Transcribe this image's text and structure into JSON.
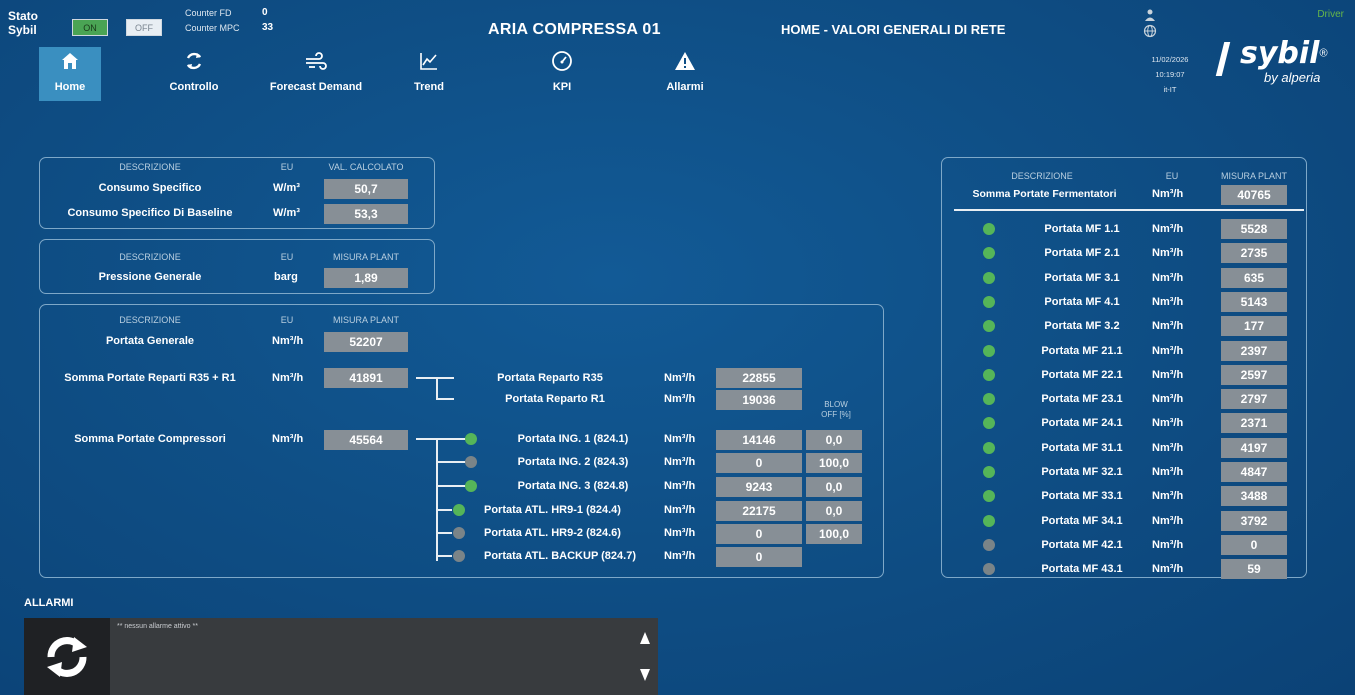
{
  "header": {
    "stato_label": "Stato\nSybil",
    "toggle_on": "ON",
    "toggle_off": "OFF",
    "counter_fd_label": "Counter FD",
    "counter_fd_value": "0",
    "counter_mpc_label": "Counter MPC",
    "counter_mpc_value": "33",
    "app_title": "ARIA COMPRESSA 01",
    "page_title": "HOME - VALORI GENERALI DI RETE",
    "driver": "Driver",
    "date": "11/02/2026",
    "time": "10:19:07",
    "locale": "it-IT",
    "logo_main": "sybil",
    "logo_reg": "®",
    "logo_by": "by alperia"
  },
  "nav": [
    {
      "label": "Home",
      "icon": "home-icon"
    },
    {
      "label": "Controllo",
      "icon": "cycle-icon"
    },
    {
      "label": "Forecast Demand",
      "icon": "wind-icon"
    },
    {
      "label": "Trend",
      "icon": "trend-chart-icon"
    },
    {
      "label": "KPI",
      "icon": "gauge-icon"
    },
    {
      "label": "Allarmi",
      "icon": "warning-icon"
    }
  ],
  "panel_consumo": {
    "h_desc": "DESCRIZIONE",
    "h_eu": "EU",
    "h_val": "VAL. CALCOLATO",
    "rows": [
      {
        "label": "Consumo Specifico",
        "unit": "W/m³",
        "value": "50,7"
      },
      {
        "label": "Consumo Specifico Di Baseline",
        "unit": "W/m³",
        "value": "53,3"
      }
    ]
  },
  "panel_pressione": {
    "h_desc": "DESCRIZIONE",
    "h_eu": "EU",
    "h_val": "MISURA PLANT",
    "rows": [
      {
        "label": "Pressione Generale",
        "unit": "barg",
        "value": "1,89"
      }
    ]
  },
  "panel_portata": {
    "h_desc": "DESCRIZIONE",
    "h_eu": "EU",
    "h_val": "MISURA PLANT",
    "blowoff": "BLOW\nOFF [%]",
    "generale": {
      "label": "Portata Generale",
      "unit": "Nm³/h",
      "value": "52207"
    },
    "reparti": {
      "label": "Somma Portate Reparti R35 + R1",
      "unit": "Nm³/h",
      "value": "41891"
    },
    "compressori": {
      "label": "Somma Portate Compressori",
      "unit": "Nm³/h",
      "value": "45564"
    },
    "reparti_children": [
      {
        "label": "Portata Reparto R35",
        "unit": "Nm³/h",
        "value": "22855"
      },
      {
        "label": "Portata Reparto R1",
        "unit": "Nm³/h",
        "value": "19036"
      }
    ],
    "compressori_children": [
      {
        "label": "Portata ING. 1 (824.1)",
        "unit": "Nm³/h",
        "value": "14146",
        "blowoff": "0,0",
        "status": "green"
      },
      {
        "label": "Portata ING. 2 (824.3)",
        "unit": "Nm³/h",
        "value": "0",
        "blowoff": "100,0",
        "status": "grey"
      },
      {
        "label": "Portata ING. 3 (824.8)",
        "unit": "Nm³/h",
        "value": "9243",
        "blowoff": "0,0",
        "status": "green"
      },
      {
        "label": "Portata ATL. HR9-1 (824.4)",
        "unit": "Nm³/h",
        "value": "22175",
        "blowoff": "0,0",
        "status": "green"
      },
      {
        "label": "Portata ATL. HR9-2 (824.6)",
        "unit": "Nm³/h",
        "value": "0",
        "blowoff": "100,0",
        "status": "grey"
      },
      {
        "label": "Portata ATL. BACKUP (824.7)",
        "unit": "Nm³/h",
        "value": "0",
        "blowoff": "",
        "status": "grey"
      }
    ]
  },
  "panel_fermentatori": {
    "h_desc": "DESCRIZIONE",
    "h_eu": "EU",
    "h_val": "MISURA PLANT",
    "somma": {
      "label": "Somma Portate Fermentatori",
      "unit": "Nm³/h",
      "value": "40765"
    },
    "rows": [
      {
        "label": "Portata MF 1.1",
        "unit": "Nm³/h",
        "value": "5528",
        "status": "green"
      },
      {
        "label": "Portata MF 2.1",
        "unit": "Nm³/h",
        "value": "2735",
        "status": "green"
      },
      {
        "label": "Portata MF 3.1",
        "unit": "Nm³/h",
        "value": "635",
        "status": "green"
      },
      {
        "label": "Portata MF 4.1",
        "unit": "Nm³/h",
        "value": "5143",
        "status": "green"
      },
      {
        "label": "Portata MF 3.2",
        "unit": "Nm³/h",
        "value": "177",
        "status": "green"
      },
      {
        "label": "Portata MF 21.1",
        "unit": "Nm³/h",
        "value": "2397",
        "status": "green"
      },
      {
        "label": "Portata MF 22.1",
        "unit": "Nm³/h",
        "value": "2597",
        "status": "green"
      },
      {
        "label": "Portata MF 23.1",
        "unit": "Nm³/h",
        "value": "2797",
        "status": "green"
      },
      {
        "label": "Portata MF 24.1",
        "unit": "Nm³/h",
        "value": "2371",
        "status": "green"
      },
      {
        "label": "Portata MF 31.1",
        "unit": "Nm³/h",
        "value": "4197",
        "status": "green"
      },
      {
        "label": "Portata MF 32.1",
        "unit": "Nm³/h",
        "value": "4847",
        "status": "green"
      },
      {
        "label": "Portata MF 33.1",
        "unit": "Nm³/h",
        "value": "3488",
        "status": "green"
      },
      {
        "label": "Portata MF 34.1",
        "unit": "Nm³/h",
        "value": "3792",
        "status": "green"
      },
      {
        "label": "Portata MF 42.1",
        "unit": "Nm³/h",
        "value": "0",
        "status": "grey"
      },
      {
        "label": "Portata MF 43.1",
        "unit": "Nm³/h",
        "value": "59",
        "status": "grey"
      }
    ]
  },
  "alarms": {
    "title": "ALLARMI",
    "message": "** nessun allarme attivo **"
  },
  "colors": {
    "background": "#0f4f86",
    "status_green": "#55b559",
    "status_grey": "#7a8488",
    "value_box": "#878f96",
    "nav_active": "#3a8fc0",
    "driver_text": "#66b64a"
  }
}
